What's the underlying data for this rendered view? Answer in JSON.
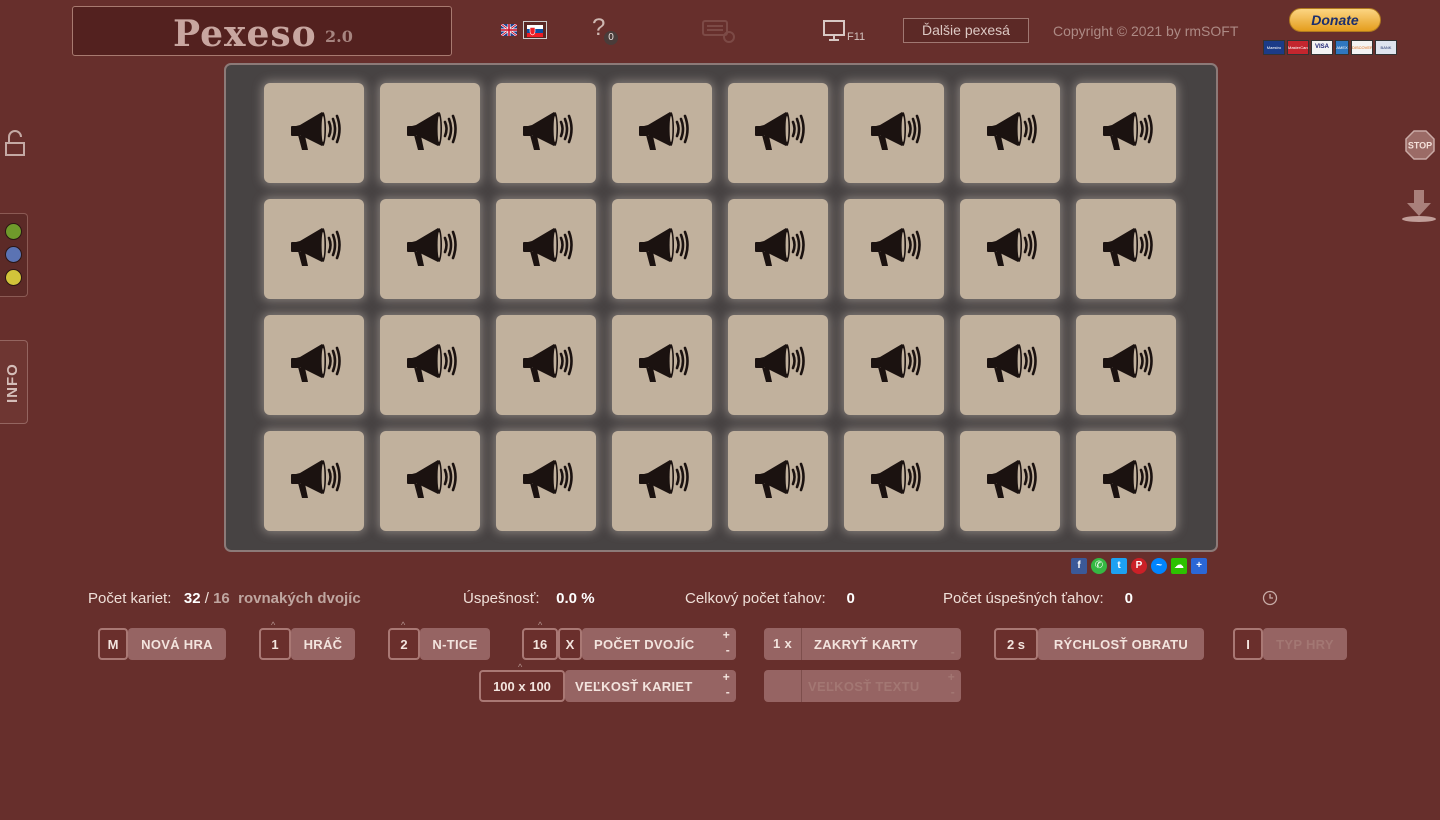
{
  "header": {
    "title": "Pexeso",
    "version": "2.0",
    "help_symbol": "?",
    "help_badge": "0",
    "fullscreen_key": "F11",
    "more_games_label": "Ďalšie pexesá",
    "copyright": "Copyright © 2021 by rmSOFT",
    "donate_label": "Donate",
    "languages": [
      "english-flag",
      "slovak-flag"
    ],
    "payment_logos": [
      "Maestro",
      "MasterCard",
      "VISA",
      "AMEX",
      "DISCOVER",
      "BANK"
    ]
  },
  "sidebar": {
    "info_label": "INFO",
    "player_colors": [
      "#6f9a2b",
      "#5b73b3",
      "#d2c43a"
    ]
  },
  "board": {
    "rows": 4,
    "cols": 8,
    "card_icon": "megaphone-icon",
    "card_color": "#c1b19d"
  },
  "share": [
    "facebook-icon",
    "whatsapp-icon",
    "twitter-icon",
    "pinterest-icon",
    "messenger-icon",
    "wechat-icon",
    "more-icon"
  ],
  "stats": {
    "cards_label": "Počet kariet:",
    "cards_value": "32",
    "cards_sep": "/",
    "pairs_value": "16",
    "pairs_label": "rovnakých dvojíc",
    "success_label": "Úspešnosť:",
    "success_value": "0.0 %",
    "moves_label": "Celkový počet ťahov:",
    "moves_value": "0",
    "success_moves_label": "Počet úspešných ťahov:",
    "success_moves_value": "0"
  },
  "controls": {
    "new_game_key": "M",
    "new_game_label": "NOVÁ HRA",
    "player_key": "1",
    "player_label": "HRÁČ",
    "ntice_key": "2",
    "ntice_label": "N-TICE",
    "pairs_key": "16",
    "pairs_x": "X",
    "pairs_label": "POČET DVOJÍC",
    "cover_key": "1 x",
    "cover_label": "ZAKRYŤ KARTY",
    "speed_key": "2 s",
    "speed_label": "RÝCHLOSŤ OBRATU",
    "type_key": "I",
    "type_label": "TYP HRY",
    "card_size_key": "100 x 100",
    "card_size_label": "VEĽKOSŤ KARIET",
    "text_size_label": "VEĽKOSŤ TEXTU",
    "plus": "+",
    "minus": "-",
    "caret": "^"
  }
}
